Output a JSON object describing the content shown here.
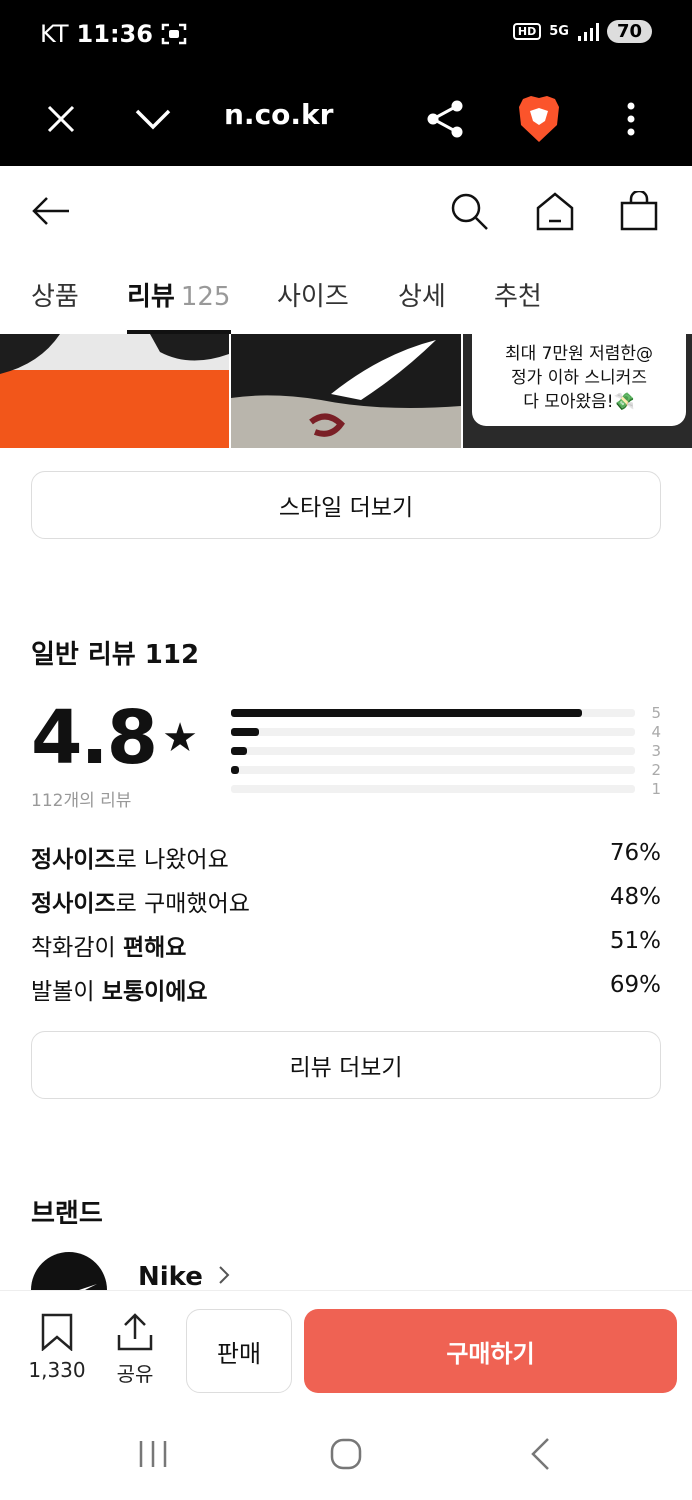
{
  "status_bar": {
    "carrier": "KT",
    "time": "11:36",
    "hd": "HD",
    "network": "5G",
    "battery": "70"
  },
  "browser": {
    "url": "n.co.kr"
  },
  "tabs": [
    {
      "label": "상품"
    },
    {
      "label": "리뷰",
      "count": "125"
    },
    {
      "label": "사이즈"
    },
    {
      "label": "상세"
    },
    {
      "label": "추천"
    }
  ],
  "promo": {
    "line1": "최대 7만원 저렴한@",
    "line2": "정가 이하 스니커즈",
    "line3": "다 모아왔음!💸"
  },
  "style_more_label": "스타일 더보기",
  "reviews": {
    "title": "일반 리뷰 112",
    "rating": "4.8",
    "review_count_text": "112개의 리뷰",
    "distribution": [
      {
        "star": "5",
        "fraction": 0.87
      },
      {
        "star": "4",
        "fraction": 0.07
      },
      {
        "star": "3",
        "fraction": 0.04
      },
      {
        "star": "2",
        "fraction": 0.02
      },
      {
        "star": "1",
        "fraction": 0.0
      }
    ],
    "stats": [
      {
        "bold": "정사이즈",
        "rest": "로 나왔어요",
        "value": "76%"
      },
      {
        "bold": "정사이즈",
        "rest": "로 구매했어요",
        "value": "48%"
      },
      {
        "prefix": "착화감이 ",
        "bold": "편해요",
        "value": "51%"
      },
      {
        "prefix": "발볼이 ",
        "bold": "보통이에요",
        "value": "69%"
      }
    ],
    "more_label": "리뷰 더보기"
  },
  "brand": {
    "section_title": "브랜드",
    "name": "Nike"
  },
  "action_bar": {
    "wishlist_count": "1,330",
    "share_label": "공유",
    "sell_label": "판매",
    "buy_label": "구매하기"
  },
  "colors": {
    "buy": "#ef6253",
    "text": "#111111",
    "muted": "#999999"
  }
}
